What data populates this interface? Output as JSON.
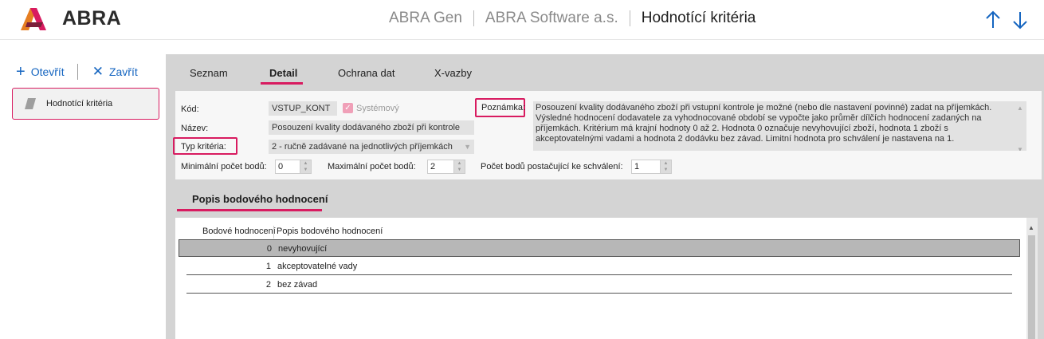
{
  "app": {
    "brand": "ABRA",
    "titles": [
      "ABRA Gen",
      "ABRA Software a.s.",
      "Hodnotící kritéria"
    ],
    "colors": {
      "accent": "#d81b60",
      "link": "#1565c0"
    }
  },
  "nav": {
    "up_icon": "arrow-up-icon",
    "down_icon": "arrow-down-icon"
  },
  "left": {
    "open_label": "Otevřít",
    "close_label": "Zavřít",
    "open_icon": "plus-icon",
    "close_icon": "close-x-icon",
    "doc_item": "Hodnotící kritéria"
  },
  "tabs": [
    {
      "label": "Seznam",
      "active": false
    },
    {
      "label": "Detail",
      "active": true
    },
    {
      "label": "Ochrana dat",
      "active": false
    },
    {
      "label": "X-vazby",
      "active": false
    }
  ],
  "form": {
    "kod_label": "Kód:",
    "kod_value": "VSTUP_KONT",
    "systemovy_label": "Systémový",
    "systemovy_checked": true,
    "nazev_label": "Název:",
    "nazev_value": "Posouzení kvality dodávaného zboží při kontrole",
    "typ_label": "Typ kritéria:",
    "typ_value": "2 - ručně zadávané na jednotlivých příjemkách",
    "poznamka_label": "Poznámka:",
    "poznamka_value": "Posouzení kvality dodávaného zboží při vstupní kontrole je možné (nebo dle nastavení povinné) zadat na příjemkách. Výsledné hodnocení dodavatele za vyhodnocované období se vypočte jako průměr dílčích hodnocení zadaných na příjemkách. Kritérium má krajní hodnoty 0 až 2. Hodnota 0 označuje nevyhovující zboží, hodnota 1 zboží s akceptovatelnými vadami a hodnota 2 dodávku bez závad. Limitní hodnota pro schválení je nastavena na 1.",
    "min_label": "Minimální počet bodů:",
    "min_value": "0",
    "max_label": "Maximální počet bodů:",
    "max_value": "2",
    "pass_label": "Počet bodů postačující ke schválení:",
    "pass_value": "1"
  },
  "subtab": {
    "label": "Popis bodového hodnocení"
  },
  "grid": {
    "columns": [
      "Bodové hodnocení",
      "Popis bodového hodnocení"
    ],
    "rows": [
      {
        "points": "0",
        "desc": "nevyhovující",
        "selected": true
      },
      {
        "points": "1",
        "desc": "akceptovatelné vady",
        "selected": false
      },
      {
        "points": "2",
        "desc": "bez závad",
        "selected": false
      }
    ]
  }
}
